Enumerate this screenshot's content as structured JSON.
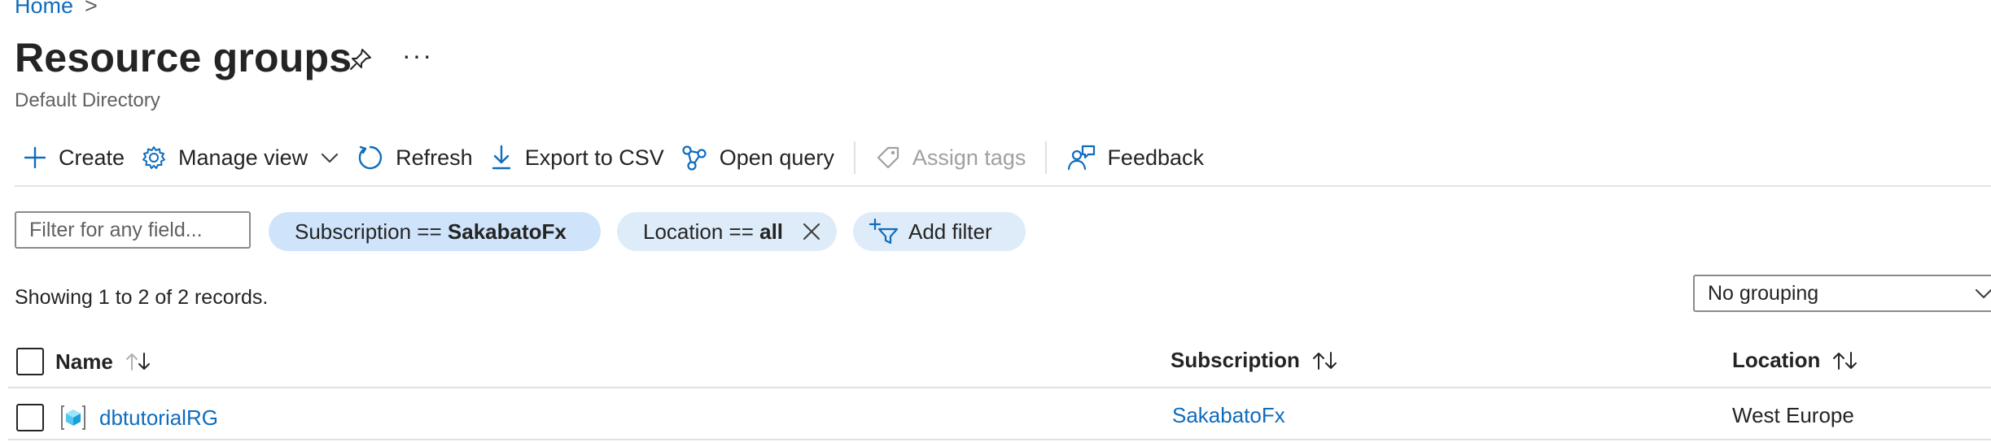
{
  "breadcrumb": {
    "home_label": "Home",
    "separator": ">"
  },
  "header": {
    "title": "Resource groups",
    "more_label": "···",
    "subtitle": "Default Directory"
  },
  "toolbar": {
    "create": "Create",
    "manage_view": "Manage view",
    "refresh": "Refresh",
    "export_csv": "Export to CSV",
    "open_query": "Open query",
    "assign_tags": "Assign tags",
    "feedback": "Feedback"
  },
  "filters": {
    "search_placeholder": "Filter for any field...",
    "subscription_prefix": "Subscription == ",
    "subscription_value": "SakabatoFx",
    "location_prefix": "Location == ",
    "location_value": "all",
    "add_filter": "Add filter"
  },
  "records_text": "Showing 1 to 2 of 2 records.",
  "grouping": {
    "selected": "No grouping"
  },
  "table": {
    "columns": {
      "name": "Name",
      "subscription": "Subscription",
      "location": "Location"
    },
    "rows": [
      {
        "name": "dbtutorialRG",
        "subscription": "SakabatoFx",
        "location": "West Europe"
      }
    ]
  },
  "colors": {
    "accent": "#0f6cbd",
    "pill": "#deecf9",
    "text": "#242424"
  },
  "icons": [
    "pin-icon",
    "plus-icon",
    "gear-icon",
    "chevron-down-icon",
    "refresh-icon",
    "download-icon",
    "query-icon",
    "tag-icon",
    "feedback-icon",
    "close-icon",
    "add-filter-icon",
    "sort-icon",
    "resource-group-icon"
  ]
}
